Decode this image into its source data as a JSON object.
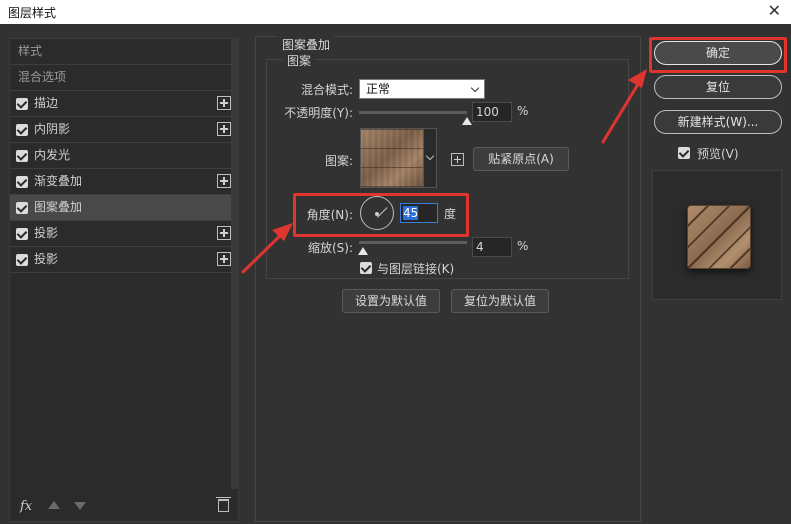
{
  "window": {
    "title": "图层样式",
    "close_symbol": "✕"
  },
  "left_panel": {
    "items": [
      {
        "label": "样式",
        "type": "header"
      },
      {
        "label": "混合选项",
        "type": "header"
      },
      {
        "label": "描边",
        "checked": true,
        "has_plus": true
      },
      {
        "label": "内阴影",
        "checked": true,
        "has_plus": true
      },
      {
        "label": "内发光",
        "checked": true,
        "has_plus": false
      },
      {
        "label": "渐变叠加",
        "checked": true,
        "has_plus": true
      },
      {
        "label": "图案叠加",
        "checked": true,
        "has_plus": false,
        "selected": true
      },
      {
        "label": "投影",
        "checked": true,
        "has_plus": true
      },
      {
        "label": "投影",
        "checked": true,
        "has_plus": true
      }
    ],
    "footer": {
      "fx_label": "fx"
    }
  },
  "pattern_overlay": {
    "group_title": "图案叠加",
    "subgroup_title": "图案",
    "blend_mode_label": "混合模式:",
    "blend_mode_value": "正常",
    "opacity_label": "不透明度(Y):",
    "opacity_value": "100",
    "opacity_unit": "%",
    "opacity_fraction": 1.0,
    "pattern_label": "图案:",
    "snap_origin_button": "贴紧原点(A)",
    "angle_label": "角度(N):",
    "angle_value": "45",
    "angle_unit": "度",
    "scale_label": "缩放(S):",
    "scale_value": "4",
    "scale_unit": "%",
    "scale_fraction": 0.04,
    "link_label": "与图层链接(K)",
    "link_checked": true,
    "set_default_button": "设置为默认值",
    "reset_default_button": "复位为默认值"
  },
  "right_panel": {
    "ok_button": "确定",
    "reset_button": "复位",
    "new_style_button": "新建样式(W)...",
    "preview_label": "预览(V)",
    "preview_checked": true
  },
  "annotations": {
    "highlight_color": "#e0352f"
  }
}
